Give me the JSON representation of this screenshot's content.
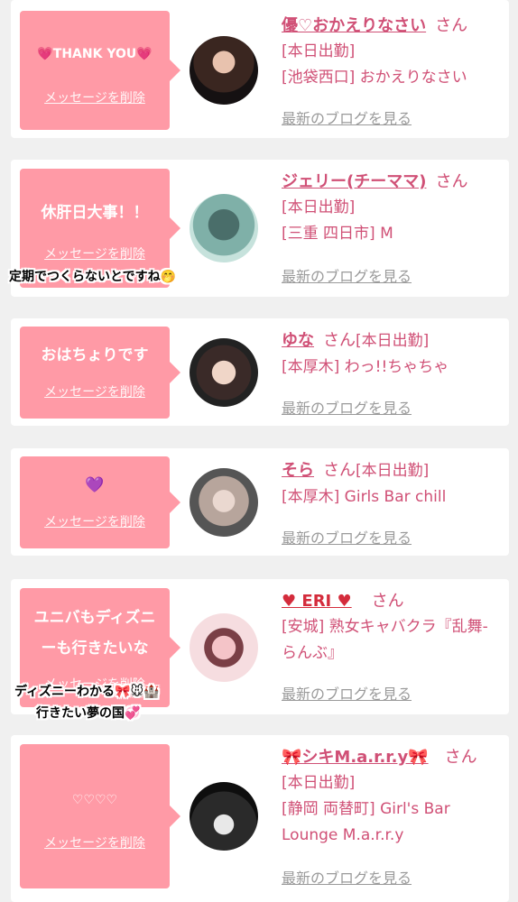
{
  "delete_label": "メッセージを削除",
  "blog_label": "最新のブログを見る",
  "san_label": "さん",
  "items": [
    {
      "message": "💗THANK YOU💗",
      "name": "優♡おかえりなさい",
      "lines": [
        "[本日出勤]",
        "[池袋西口] おかえりなさい"
      ]
    },
    {
      "message": "休肝日大事！！",
      "name": "ジェリー(チーママ)",
      "lines": [
        "[本日出勤]",
        "[三重 四日市] M"
      ],
      "overlay": "定期でつくらないとですね🤭"
    },
    {
      "message": "おはちょりです",
      "name": "ゆな",
      "status_inline": "[本日出勤]",
      "lines": [
        "[本厚木] わっ!!ちゃちゃ"
      ]
    },
    {
      "message": "💜",
      "name": "そら",
      "status_inline": "[本日出勤]",
      "lines": [
        "[本厚木] Girls Bar chill"
      ]
    },
    {
      "message_lines": [
        "ユニバもディズニ",
        "ーも行きたいな"
      ],
      "name": "♥ ERI ♥",
      "lines": [
        "[安城] 熟女キャバクラ『乱舞-らんぶ』"
      ],
      "overlay_lines": [
        "ディズニーわかる🎀🐭🏰",
        "行きたい夢の国💞"
      ]
    },
    {
      "message": "♡♡♡♡",
      "name": "🎀シキM.a.r.r.y🎀",
      "lines": [
        "[本日出勤]",
        "[静岡 両替町] Girl's Bar Lounge M.a.r.r.y"
      ]
    }
  ],
  "colors": {
    "bubble": "#ff9aa6",
    "name": "#d05076",
    "blog_link": "#9a9a9a",
    "background": "#f0f0f0"
  }
}
